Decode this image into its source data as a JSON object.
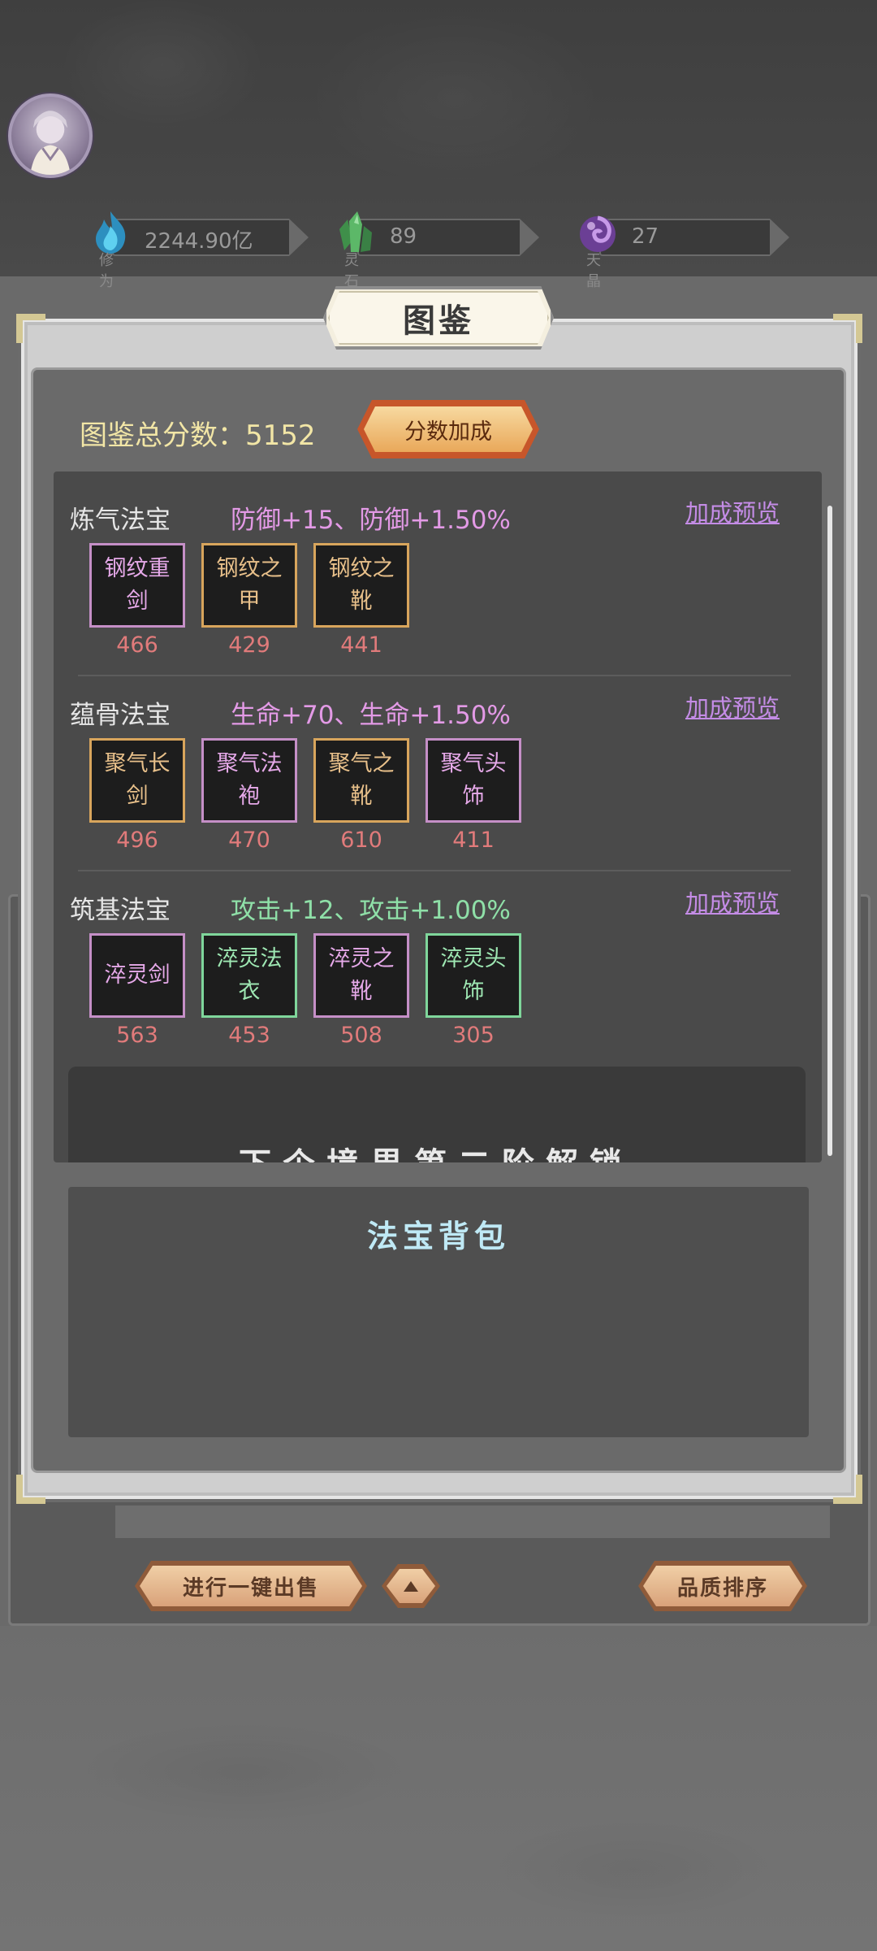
{
  "resources": [
    {
      "label": "修为",
      "value": "2244.90亿",
      "icon": "blue-flame-icon",
      "color": "#39a5d6"
    },
    {
      "label": "灵石",
      "value": "89",
      "icon": "green-crystal-icon",
      "color": "#5db866"
    },
    {
      "label": "天晶",
      "value": "27",
      "icon": "purple-orb-icon",
      "color": "#8a5bb8"
    }
  ],
  "dialog": {
    "title": "图鉴",
    "score_label": "图鉴总分数：",
    "score_value": "5152",
    "bonus_button": "分数加成"
  },
  "sections": [
    {
      "name": "炼气法宝",
      "bonus": "防御+15、防御+1.50%",
      "bonus_color": "#e39ae6",
      "preview": "加成预览",
      "items": [
        {
          "name": "钢纹重剑",
          "score": "466",
          "quality": "purple"
        },
        {
          "name": "钢纹之甲",
          "score": "429",
          "quality": "orange"
        },
        {
          "name": "钢纹之靴",
          "score": "441",
          "quality": "orange"
        }
      ]
    },
    {
      "name": "蕴骨法宝",
      "bonus": "生命+70、生命+1.50%",
      "bonus_color": "#e39ae6",
      "preview": "加成预览",
      "items": [
        {
          "name": "聚气长剑",
          "score": "496",
          "quality": "orange"
        },
        {
          "name": "聚气法袍",
          "score": "470",
          "quality": "purple"
        },
        {
          "name": "聚气之靴",
          "score": "610",
          "quality": "orange"
        },
        {
          "name": "聚气头饰",
          "score": "411",
          "quality": "purple"
        }
      ]
    },
    {
      "name": "筑基法宝",
      "bonus": "攻击+12、攻击+1.00%",
      "bonus_color": "#8fe0a8",
      "preview": "加成预览",
      "items": [
        {
          "name": "淬灵剑",
          "score": "563",
          "quality": "purple"
        },
        {
          "name": "淬灵法衣",
          "score": "453",
          "quality": "green"
        },
        {
          "name": "淬灵之靴",
          "score": "508",
          "quality": "purple"
        },
        {
          "name": "淬灵头饰",
          "score": "305",
          "quality": "green"
        }
      ]
    }
  ],
  "next_card_text": "下个境界第二阶解锁",
  "bag": {
    "title": "法宝背包"
  },
  "bottom": {
    "sell_button": "进行一键出售",
    "sort_button": "品质排序"
  }
}
